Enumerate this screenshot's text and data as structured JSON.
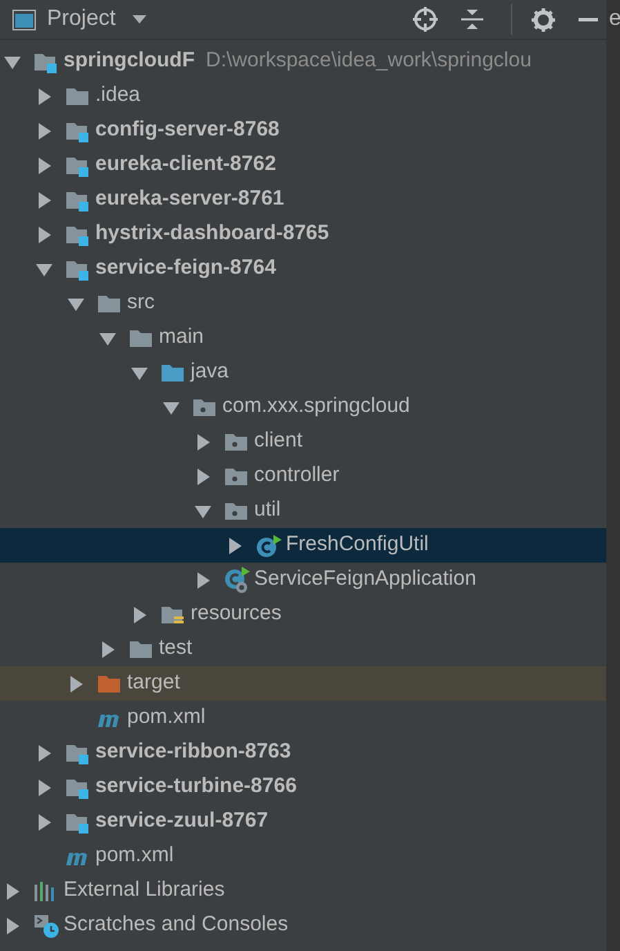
{
  "header": {
    "title": "Project",
    "cut_label": "e"
  },
  "tree": [
    {
      "label": "springcloudF",
      "path": "D:\\workspace\\idea_work\\springclou",
      "kind": "module",
      "bold": true,
      "expanded": true,
      "selected": false,
      "children": [
        {
          "label": ".idea",
          "kind": "folder",
          "expanded": false,
          "selected": false
        },
        {
          "label": "config-server-8768",
          "kind": "module",
          "bold": true,
          "expanded": false,
          "selected": false
        },
        {
          "label": "eureka-client-8762",
          "kind": "module",
          "bold": true,
          "expanded": false,
          "selected": false
        },
        {
          "label": "eureka-server-8761",
          "kind": "module",
          "bold": true,
          "expanded": false,
          "selected": false
        },
        {
          "label": "hystrix-dashboard-8765",
          "kind": "module",
          "bold": true,
          "expanded": false,
          "selected": false
        },
        {
          "label": "service-feign-8764",
          "kind": "module",
          "bold": true,
          "expanded": true,
          "selected": false,
          "children": [
            {
              "label": "src",
              "kind": "folder",
              "expanded": true,
              "selected": false,
              "children": [
                {
                  "label": "main",
                  "kind": "folder",
                  "expanded": true,
                  "selected": false,
                  "children": [
                    {
                      "label": "java",
                      "kind": "source",
                      "expanded": true,
                      "selected": false,
                      "children": [
                        {
                          "label": "com.xxx.springcloud",
                          "kind": "package",
                          "expanded": true,
                          "selected": false,
                          "children": [
                            {
                              "label": "client",
                              "kind": "package",
                              "expanded": false,
                              "selected": false
                            },
                            {
                              "label": "controller",
                              "kind": "package",
                              "expanded": false,
                              "selected": false
                            },
                            {
                              "label": "util",
                              "kind": "package",
                              "expanded": true,
                              "selected": false,
                              "children": [
                                {
                                  "label": "FreshConfigUtil",
                                  "kind": "class",
                                  "expanded": false,
                                  "selected": true
                                }
                              ]
                            },
                            {
                              "label": "ServiceFeignApplication",
                              "kind": "app",
                              "expanded": false,
                              "selected": false
                            }
                          ]
                        }
                      ]
                    },
                    {
                      "label": "resources",
                      "kind": "resources",
                      "expanded": false,
                      "selected": false
                    }
                  ]
                },
                {
                  "label": "test",
                  "kind": "folder",
                  "expanded": false,
                  "selected": false
                }
              ]
            },
            {
              "label": "target",
              "kind": "excluded",
              "expanded": false,
              "selected": false
            },
            {
              "label": "pom.xml",
              "kind": "maven",
              "selected": false
            }
          ]
        },
        {
          "label": "service-ribbon-8763",
          "kind": "module",
          "bold": true,
          "expanded": false,
          "selected": false
        },
        {
          "label": "service-turbine-8766",
          "kind": "module",
          "bold": true,
          "expanded": false,
          "selected": false
        },
        {
          "label": "service-zuul-8767",
          "kind": "module",
          "bold": true,
          "expanded": false,
          "selected": false
        },
        {
          "label": "pom.xml",
          "kind": "maven",
          "selected": false
        }
      ]
    },
    {
      "label": "External Libraries",
      "kind": "libraries",
      "expanded": false,
      "selected": false
    },
    {
      "label": "Scratches and Consoles",
      "kind": "scratches",
      "expanded": false,
      "selected": false
    }
  ]
}
